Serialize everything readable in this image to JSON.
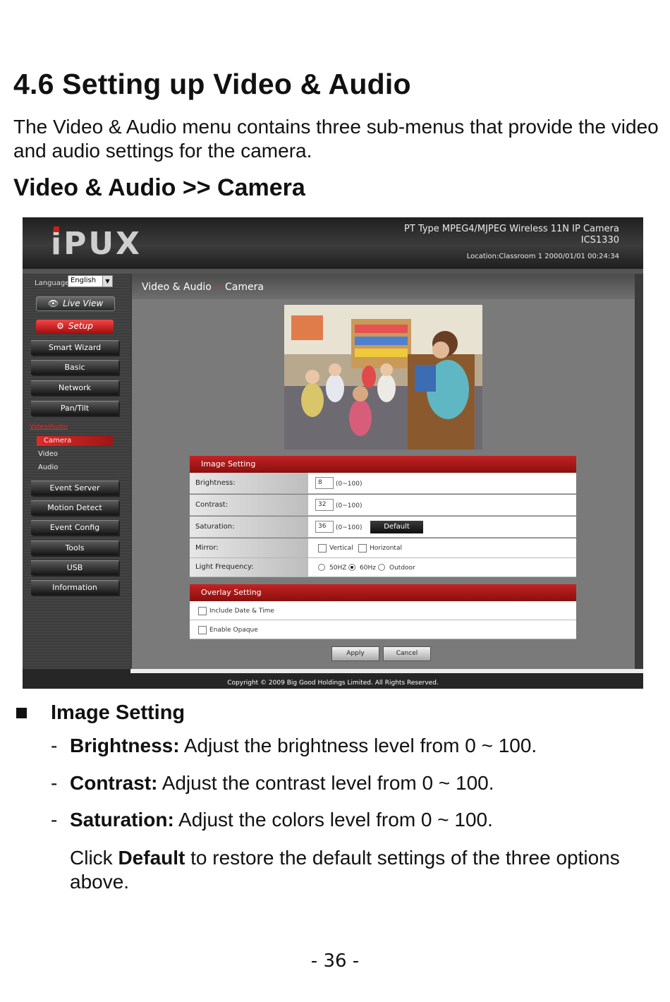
{
  "heading": "4.6  Setting up Video & Audio",
  "intro": "The Video & Audio menu contains three sub-menus that provide the video and audio settings for the camera.",
  "subheading": "Video & Audio >> Camera",
  "screenshot": {
    "logo": "iPUX",
    "product_line1": "PT Type MPEG4/MJPEG Wireless 11N IP Camera",
    "product_line2": "ICS1330",
    "location": "Location:Classroom 1   2000/01/01 00:24:34",
    "language_label": "Language",
    "language_value": "English",
    "live_view": "Live View",
    "setup": "Setup",
    "nav": [
      "Smart Wizard",
      "Basic",
      "Network",
      "Pan/Tilt"
    ],
    "section_link": "Video/Audio",
    "subnav": [
      "Camera",
      "Video",
      "Audio"
    ],
    "nav2": [
      "Event Server",
      "Motion Detect",
      "Event Config",
      "Tools",
      "USB",
      "Information"
    ],
    "breadcrumb_1": "Video & Audio",
    "breadcrumb_sep": "›",
    "breadcrumb_2": "Camera",
    "image_setting_title": "Image Setting",
    "brightness_label": "Brightness:",
    "brightness_value": "8",
    "contrast_label": "Contrast:",
    "contrast_value": "32",
    "saturation_label": "Saturation:",
    "saturation_value": "36",
    "range": "(0~100)",
    "default_button": "Default",
    "mirror_label": "Mirror:",
    "mirror_vertical": "Vertical",
    "mirror_horizontal": "Horizontal",
    "light_label": "Light Frequency:",
    "light_50": "50HZ",
    "light_60": "60Hz",
    "light_outdoor": "Outdoor",
    "light_selected": "60Hz",
    "overlay_title": "Overlay Setting",
    "overlay_date": "Include Date & Time",
    "overlay_opaque": "Enable Opaque",
    "apply": "Apply",
    "cancel": "Cancel",
    "copyright": "Copyright © 2009 Big Good Holdings Limited. All Rights Reserved.",
    "accent_red": "#c32323"
  },
  "section_title": "Image Setting",
  "items": [
    {
      "dash": "-",
      "term": "Brightness:",
      "desc": " Adjust the brightness level from 0 ~ 100."
    },
    {
      "dash": "-",
      "term": "Contrast:",
      "desc": " Adjust the contrast level from 0 ~ 100."
    },
    {
      "dash": "-",
      "term": "Saturation:",
      "desc": " Adjust the colors level from 0 ~ 100."
    }
  ],
  "note_pre": "Click ",
  "note_bold": "Default",
  "note_post": " to restore the default settings of the three options above.",
  "page_number": "- 36 -"
}
